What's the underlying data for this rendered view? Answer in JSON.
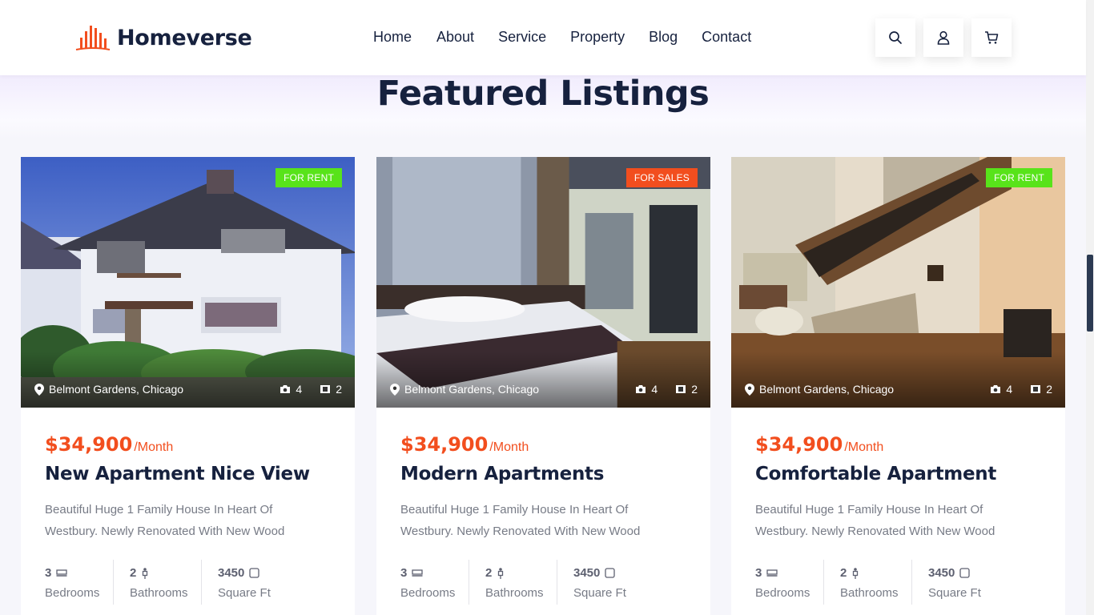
{
  "header": {
    "logo_text": "Homeverse",
    "nav": [
      "Home",
      "About",
      "Service",
      "Property",
      "Blog",
      "Contact"
    ],
    "icons": [
      "search-icon",
      "user-icon",
      "cart-icon"
    ]
  },
  "section": {
    "title": "Featured Listings"
  },
  "colors": {
    "accent": "#f24e1e",
    "navy": "#16213e",
    "rent_badge": "#58e31a",
    "sale_badge": "#f24e1e"
  },
  "listings": [
    {
      "badge": "FOR RENT",
      "location": "Belmont Gardens, Chicago",
      "photos": "4",
      "videos": "2",
      "price": "$34,900",
      "price_unit": "/Month",
      "title": "New Apartment Nice View",
      "description": "Beautiful Huge 1 Family House In Heart Of Westbury. Newly Renovated With New Wood",
      "bedrooms": "3",
      "bedrooms_label": "Bedrooms",
      "bathrooms": "2",
      "bathrooms_label": "Bathrooms",
      "area": "3450",
      "area_label": "Square Ft"
    },
    {
      "badge": "FOR SALES",
      "location": "Belmont Gardens, Chicago",
      "photos": "4",
      "videos": "2",
      "price": "$34,900",
      "price_unit": "/Month",
      "title": "Modern Apartments",
      "description": "Beautiful Huge 1 Family House In Heart Of Westbury. Newly Renovated With New Wood",
      "bedrooms": "3",
      "bedrooms_label": "Bedrooms",
      "bathrooms": "2",
      "bathrooms_label": "Bathrooms",
      "area": "3450",
      "area_label": "Square Ft"
    },
    {
      "badge": "FOR RENT",
      "location": "Belmont Gardens, Chicago",
      "photos": "4",
      "videos": "2",
      "price": "$34,900",
      "price_unit": "/Month",
      "title": "Comfortable Apartment",
      "description": "Beautiful Huge 1 Family House In Heart Of Westbury. Newly Renovated With New Wood",
      "bedrooms": "3",
      "bedrooms_label": "Bedrooms",
      "bathrooms": "2",
      "bathrooms_label": "Bathrooms",
      "area": "3450",
      "area_label": "Square Ft"
    }
  ]
}
